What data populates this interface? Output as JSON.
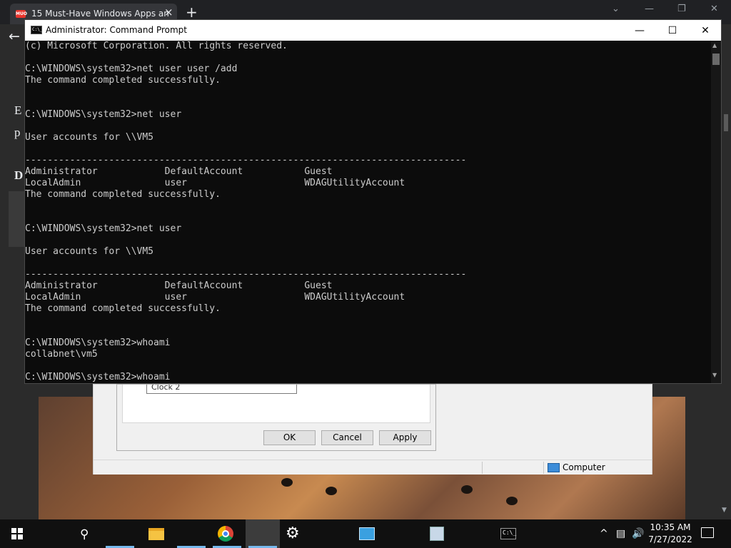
{
  "browser": {
    "tab_title": "15 Must-Have Windows Apps an",
    "favicon_text": "MUO",
    "new_tab_symbol": "+",
    "close_symbol": "×",
    "bg_text_1": "E",
    "bg_text_2": "p",
    "bg_text_3": "D"
  },
  "props_dialog": {
    "field_value": "Clock 2",
    "ok_label": "OK",
    "cancel_label": "Cancel",
    "apply_label": "Apply",
    "status_computer": "Computer"
  },
  "cmd": {
    "title": "Administrator: Command Prompt",
    "icon_text": "C:\\_",
    "lines": [
      "(c) Microsoft Corporation. All rights reserved.",
      "",
      "C:\\WINDOWS\\system32>net user user /add",
      "The command completed successfully.",
      "",
      "",
      "C:\\WINDOWS\\system32>net user",
      "",
      "User accounts for \\\\VM5",
      "",
      "-------------------------------------------------------------------------------",
      "Administrator            DefaultAccount           Guest",
      "LocalAdmin               user                     WDAGUtilityAccount",
      "The command completed successfully.",
      "",
      "",
      "C:\\WINDOWS\\system32>net user",
      "",
      "User accounts for \\\\VM5",
      "",
      "-------------------------------------------------------------------------------",
      "Administrator            DefaultAccount           Guest",
      "LocalAdmin               user                     WDAGUtilityAccount",
      "The command completed successfully.",
      "",
      "",
      "C:\\WINDOWS\\system32>whoami",
      "collabnet\\vm5",
      "",
      "C:\\WINDOWS\\system32>whoami"
    ]
  },
  "taskbar": {
    "time": "10:35 AM",
    "date": "7/27/2022",
    "tray_chevron": "^"
  }
}
